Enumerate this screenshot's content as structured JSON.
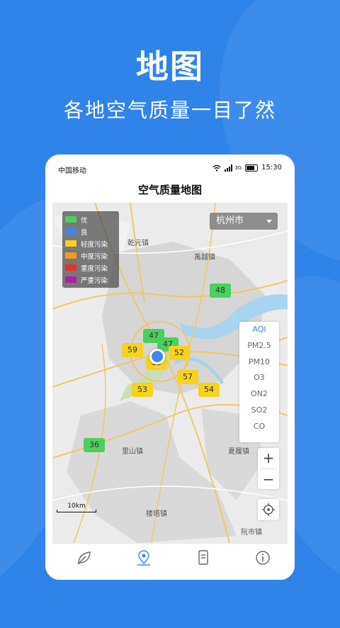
{
  "hero": {
    "title": "地图",
    "subtitle": "各地空气质量一目了然"
  },
  "status_bar": {
    "carrier": "中国移动",
    "network": "3G",
    "time": "15:30"
  },
  "app_bar": {
    "title": "空气质量地图"
  },
  "city_select": {
    "value": "杭州市"
  },
  "legend": [
    {
      "label": "优",
      "color": "#4ccf5e"
    },
    {
      "label": "良",
      "color": "#3f86f0"
    },
    {
      "label": "轻度污染",
      "color": "#f7d21f"
    },
    {
      "label": "中度污染",
      "color": "#f39a1e"
    },
    {
      "label": "重度污染",
      "color": "#e8312a"
    },
    {
      "label": "严重污染",
      "color": "#b01fa0"
    }
  ],
  "map_labels": [
    "乾元镇",
    "禹越镇",
    "里山镇",
    "夏履镇",
    "楼塔镇",
    "阮市镇",
    "10km"
  ],
  "markers": [
    {
      "value": "48",
      "level": "优"
    },
    {
      "value": "47",
      "level": "优"
    },
    {
      "value": "47",
      "level": "优"
    },
    {
      "value": "59",
      "level": "轻度污染"
    },
    {
      "value": "52",
      "level": "轻度污染"
    },
    {
      "value": "59",
      "level": "轻度污染"
    },
    {
      "value": "57",
      "level": "轻度污染"
    },
    {
      "value": "53",
      "level": "轻度污染"
    },
    {
      "value": "54",
      "level": "轻度污染"
    },
    {
      "value": "36",
      "level": "优"
    }
  ],
  "pollutants": [
    "AQI",
    "PM2.5",
    "PM10",
    "O3",
    "ON2",
    "SO2",
    "CO"
  ],
  "pollutant_selected": "AQI",
  "zoom": {
    "in": "+",
    "out": "−"
  },
  "tabs": [
    {
      "icon": "leaf-icon"
    },
    {
      "icon": "map-pin-icon",
      "active": true
    },
    {
      "icon": "document-icon"
    },
    {
      "icon": "info-icon"
    }
  ],
  "colors": {
    "brand": "#2f84ea",
    "active": "#3f86f0"
  }
}
